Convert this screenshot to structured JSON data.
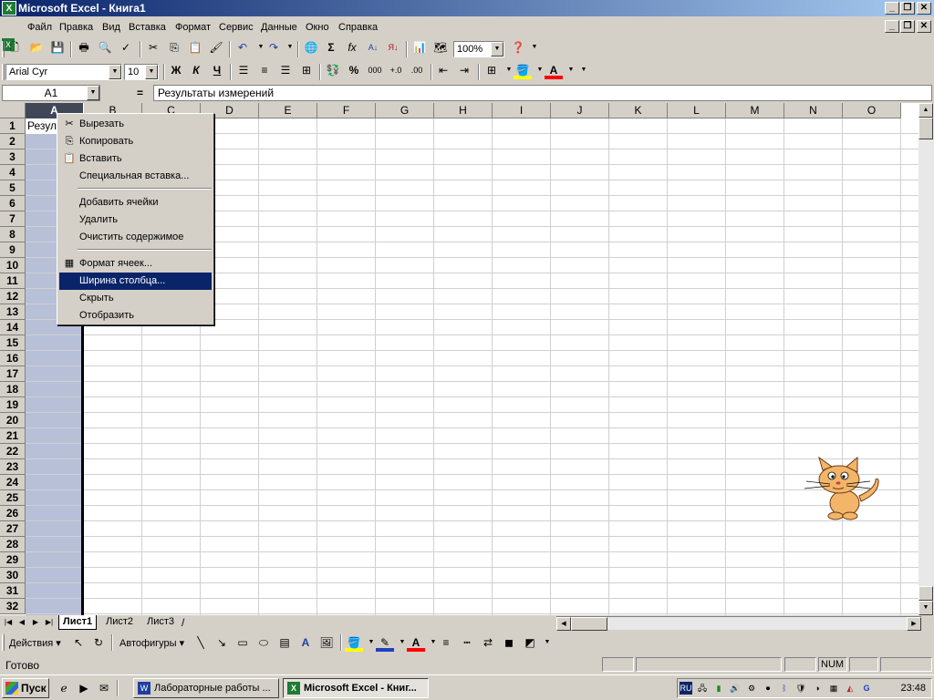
{
  "window": {
    "title": "Microsoft Excel - Книга1",
    "app_icon": "excel-icon"
  },
  "menu": [
    "Файл",
    "Правка",
    "Вид",
    "Вставка",
    "Формат",
    "Сервис",
    "Данные",
    "Окно",
    "Справка"
  ],
  "standard_toolbar": {
    "zoom": "100%"
  },
  "format_toolbar": {
    "font": "Arial Cyr",
    "size": "10",
    "bold": "Ж",
    "italic": "К",
    "underline": "Ч",
    "percent": "%",
    "thousands": "000"
  },
  "formula_bar": {
    "name_box": "A1",
    "equals": "=",
    "value": "Результаты измерений"
  },
  "columns": [
    "A",
    "B",
    "C",
    "D",
    "E",
    "F",
    "G",
    "H",
    "I",
    "J",
    "K",
    "L",
    "M",
    "N",
    "O"
  ],
  "rows": [
    "1",
    "2",
    "3",
    "4",
    "5",
    "6",
    "7",
    "8",
    "9",
    "10",
    "11",
    "12",
    "13",
    "14",
    "15",
    "16",
    "17",
    "18",
    "19",
    "20",
    "21",
    "22",
    "23",
    "24",
    "25",
    "26",
    "27",
    "28",
    "29",
    "30",
    "31",
    "32"
  ],
  "cells": {
    "A1": "Результаты измерений"
  },
  "context_menu": {
    "items": [
      {
        "label": "Вырезать",
        "icon": "scissors-icon"
      },
      {
        "label": "Копировать",
        "icon": "copy-icon"
      },
      {
        "label": "Вставить",
        "icon": "paste-icon"
      },
      {
        "label": "Специальная вставка..."
      },
      {
        "label": "Добавить ячейки"
      },
      {
        "label": "Удалить"
      },
      {
        "label": "Очистить содержимое"
      },
      {
        "label": "Формат ячеек...",
        "icon": "format-cells-icon"
      },
      {
        "label": "Ширина столбца...",
        "highlighted": true
      },
      {
        "label": "Скрыть"
      },
      {
        "label": "Отобразить"
      }
    ]
  },
  "sheet_tabs": [
    "Лист1",
    "Лист2",
    "Лист3"
  ],
  "active_sheet": "Лист1",
  "draw_toolbar": {
    "actions": "Действия",
    "autoshapes": "Автофигуры"
  },
  "status": {
    "text": "Готово",
    "num": "NUM"
  },
  "taskbar": {
    "start": "Пуск",
    "tasks": [
      {
        "label": "Лабораторные работы ...",
        "icon": "word-icon",
        "active": false
      },
      {
        "label": "Microsoft Excel - Книг...",
        "icon": "excel-icon",
        "active": true
      }
    ],
    "lang": "RU",
    "clock": "23:48"
  },
  "colors": {
    "title_start": "#0a246a",
    "title_end": "#a6caf0",
    "selection": "#b8c0d8",
    "highlight": "#0a246a"
  }
}
